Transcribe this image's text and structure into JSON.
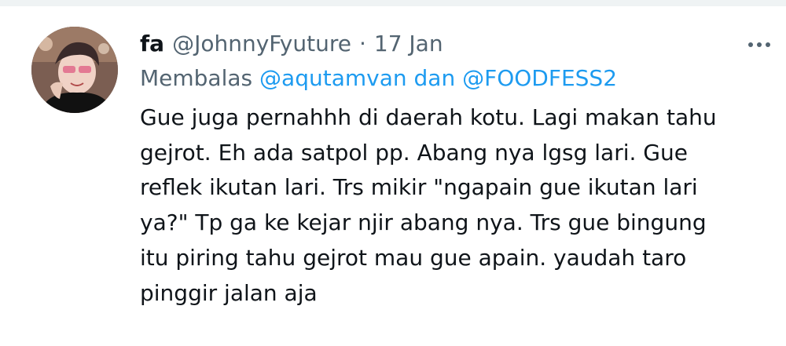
{
  "tweet": {
    "name": "fa",
    "handle": "@JohnnyFyuture",
    "separator": "·",
    "date": "17 Jan",
    "reply_prefix": "Membalas",
    "reply_mention_1": "@aqutamvan",
    "reply_conjunction": "dan",
    "reply_mention_2": "@FOODFESS2",
    "text_lines": [
      "Gue juga pernahhh di daerah kotu. Lagi makan tahu",
      "gejrot. Eh ada satpol pp. Abang nya lgsg lari. Gue",
      "reflek ikutan lari. Trs mikir \"ngapain gue ikutan lari",
      "ya?\" Tp ga ke kejar njir abang nya. Trs gue bingung",
      "itu piring tahu gejrot mau gue apain. yaudah taro",
      "pinggir jalan aja"
    ]
  },
  "icons": {
    "more": "more-horizontal-icon",
    "avatar": "profile-photo"
  },
  "colors": {
    "text_primary": "#0f1419",
    "text_secondary": "#536471",
    "mention": "#1d9bf0",
    "divider": "#eff3f4"
  }
}
